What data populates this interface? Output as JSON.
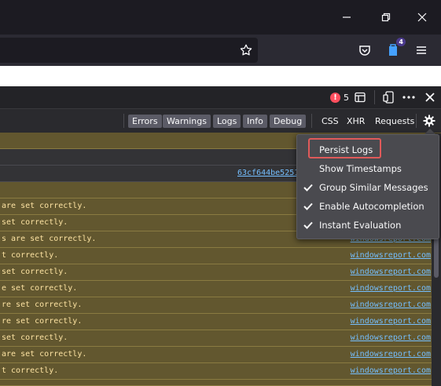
{
  "browser": {
    "window_controls": [
      "minimize-icon",
      "restore-icon",
      "close-icon"
    ],
    "toolbar_icons": [
      "bookmark-star-icon",
      "pocket-icon",
      "extension-icon",
      "menu-icon"
    ],
    "extension_badge": "4"
  },
  "devtools": {
    "error_count": "5",
    "filter_buttons": [
      {
        "label": "Errors",
        "active": true
      },
      {
        "label": "Warnings",
        "active": true
      },
      {
        "label": "Logs",
        "active": true
      },
      {
        "label": "Info",
        "active": true
      },
      {
        "label": "Debug",
        "active": true
      },
      {
        "label": "CSS",
        "active": false
      },
      {
        "label": "XHR",
        "active": false
      },
      {
        "label": "Requests",
        "active": false
      }
    ],
    "hash_link": "63cf644be5251",
    "messages": [
      {
        "text": "are set correctly.",
        "source": ""
      },
      {
        "text": " set correctly.",
        "source": ""
      },
      {
        "text": "s are set correctly.",
        "source": "windowsreport.com"
      },
      {
        "text": "t correctly.",
        "source": "windowsreport.com"
      },
      {
        "text": " set correctly.",
        "source": "windowsreport.com"
      },
      {
        "text": "e set correctly.",
        "source": "windowsreport.com"
      },
      {
        "text": "re set correctly.",
        "source": "windowsreport.com"
      },
      {
        "text": "re set correctly.",
        "source": "windowsreport.com"
      },
      {
        "text": "set correctly.",
        "source": "windowsreport.com"
      },
      {
        "text": " are set correctly.",
        "source": "windowsreport.com"
      },
      {
        "text": "t correctly.",
        "source": "windowsreport.com"
      }
    ]
  },
  "settings_menu": {
    "items": [
      {
        "label": "Persist Logs",
        "checked": false
      },
      {
        "label": "Show Timestamps",
        "checked": false
      },
      {
        "label": "Group Similar Messages",
        "checked": true
      },
      {
        "label": "Enable Autocompletion",
        "checked": true
      },
      {
        "label": "Instant Evaluation",
        "checked": true
      }
    ]
  },
  "colors": {
    "warning_bg": "#62572f",
    "link": "#75bfff",
    "highlight": "#e05a5a"
  }
}
